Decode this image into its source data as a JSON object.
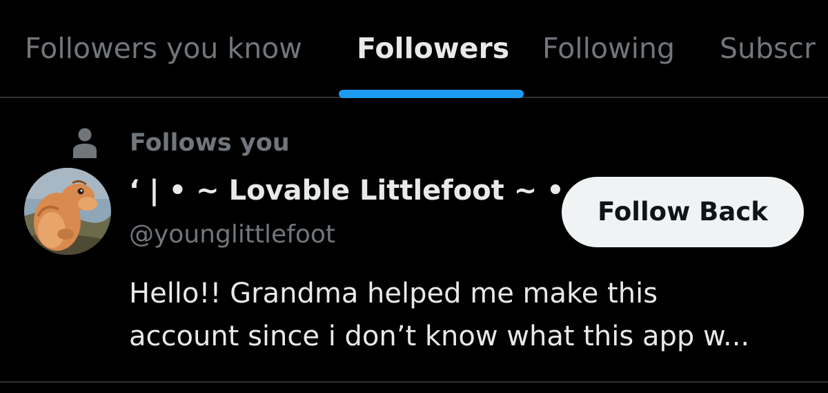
{
  "tabs": [
    {
      "label": "Followers you know",
      "active": false
    },
    {
      "label": "Followers",
      "active": true
    },
    {
      "label": "Following",
      "active": false
    },
    {
      "label": "Subscr",
      "active": false
    }
  ],
  "follower": {
    "context_icon": "person-icon",
    "context_text": "Follows you",
    "display_name": "‘ | • ~ Lovable Littlefoot ~ •...",
    "handle": "@younglittlefoot",
    "follow_button_label": "Follow Back",
    "bio_lines": [
      "Hello!! Grandma helped me make this",
      "account since i don’t know what this app w..."
    ]
  },
  "colors": {
    "background": "#000000",
    "primary_text": "#e7e9ea",
    "secondary_text": "#71767b",
    "accent": "#1d9bf0",
    "divider": "#2f3336",
    "button_bg": "#eff3f4",
    "button_text": "#0f1419"
  }
}
